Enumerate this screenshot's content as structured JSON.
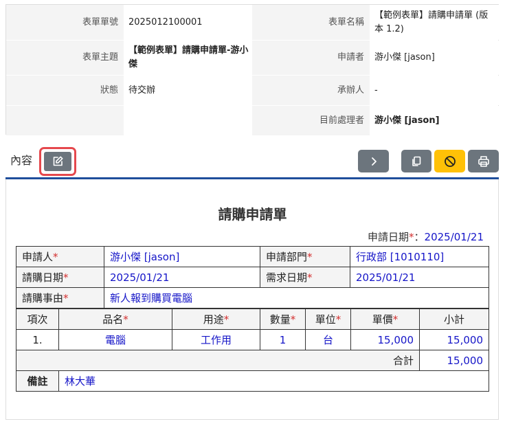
{
  "info": {
    "form_no_label": "表單單號",
    "form_no": "2025012100001",
    "form_name_label": "表單名稱",
    "form_name": "【範例表單】請購申請單 (版本 1.2)",
    "subject_label": "表單主題",
    "subject": "【範例表單】請購申請單-游小傑",
    "applicant_label": "申請者",
    "applicant": "游小傑 [jason]",
    "status_label": "狀態",
    "status": "待交辦",
    "handler_label": "承辦人",
    "handler": "-",
    "current_label": "目前處理者",
    "current": "游小傑 [jason]"
  },
  "toolbar": {
    "content_label": "內容",
    "edit_icon": "edit-icon",
    "next_icon": "chevron-right-icon",
    "copy_icon": "copy-icon",
    "cancel_icon": "ban-icon",
    "print_icon": "print-icon",
    "colors": {
      "accent": "#1f4e9b",
      "button": "#6c757d",
      "warn": "#ffc107",
      "highlight": "#e5484d"
    }
  },
  "form": {
    "title": "請購申請單",
    "apply_date_label": "申請日期",
    "apply_date": "2025/01/21",
    "applicant_label": "申請人",
    "applicant": "游小傑 [jason]",
    "dept_label": "申請部門",
    "dept": "行政部 [1010110]",
    "purchase_date_label": "請購日期",
    "purchase_date": "2025/01/21",
    "need_date_label": "需求日期",
    "need_date": "2025/01/21",
    "reason_label": "請購事由",
    "reason": "新人報到購買電腦",
    "columns": {
      "seq": "項次",
      "item": "品名",
      "usage": "用途",
      "qty": "數量",
      "unit": "單位",
      "price": "單價",
      "subtotal": "小計"
    },
    "rows": [
      {
        "seq": "1.",
        "item": "電腦",
        "usage": "工作用",
        "qty": "1",
        "unit": "台",
        "price": "15,000",
        "subtotal": "15,000"
      }
    ],
    "total_label": "合計",
    "total": "15,000",
    "remark_label": "備註",
    "remark": "林大華"
  }
}
